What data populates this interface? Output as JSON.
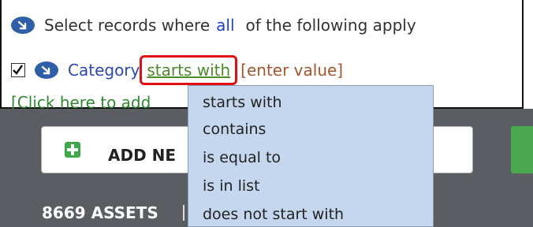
{
  "filter": {
    "row1": {
      "prefix": "Select records where",
      "match_mode": "all",
      "suffix": "of the following apply"
    },
    "row2": {
      "field": "Category",
      "operator": "starts with",
      "value": "[enter value]",
      "checked": true
    },
    "add_condition_link": "[Click here to add"
  },
  "toolbar": {
    "add_button_label": "ADD NE",
    "assets_count": "8669 ASSETS"
  },
  "dropdown": {
    "options": [
      "starts with",
      "contains",
      "is equal to",
      "is in list",
      "does not start with"
    ]
  },
  "colors": {
    "highlight_border": "#e01010",
    "dropdown_bg": "#c5d7ee",
    "operator_link": "#4c8a2a",
    "toolbar_bg": "#5a5d61"
  }
}
